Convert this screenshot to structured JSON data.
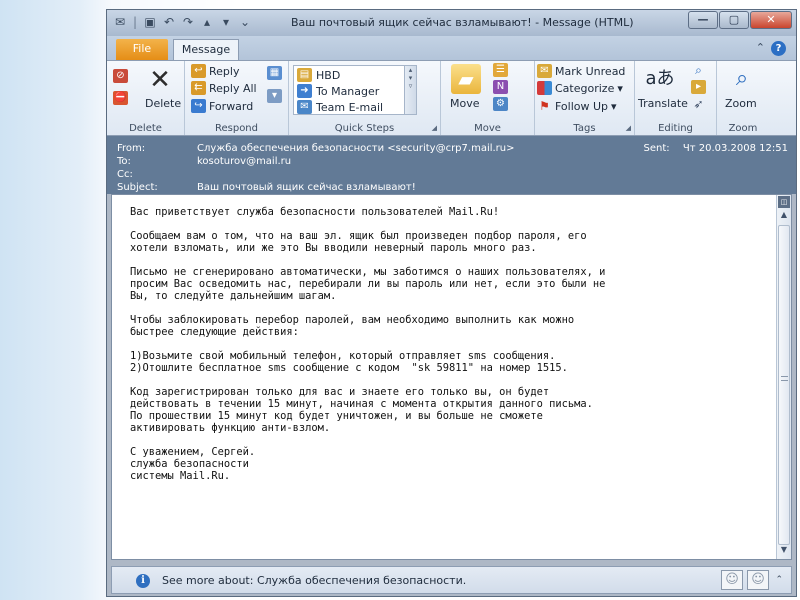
{
  "window": {
    "title": "Ваш почтовый ящик сейчас взламывают! - Message (HTML)",
    "minimize": "—",
    "maximize": "▢",
    "close": "✕"
  },
  "tabs": {
    "file": "File",
    "message": "Message"
  },
  "ribbon": {
    "delete_group": {
      "delete_label": "Delete",
      "group_label": "Delete"
    },
    "respond_group": {
      "reply": "Reply",
      "reply_all": "Reply All",
      "forward": "Forward",
      "group_label": "Respond"
    },
    "quick_steps_group": {
      "items": [
        "HBD",
        "To Manager",
        "Team E-mail"
      ],
      "group_label": "Quick Steps"
    },
    "move_group": {
      "move": "Move",
      "group_label": "Move"
    },
    "tags_group": {
      "mark_unread": "Mark Unread",
      "categorize": "Categorize",
      "follow_up": "Follow Up",
      "group_label": "Tags"
    },
    "editing_group": {
      "translate": "Translate",
      "group_label": "Editing"
    },
    "zoom_group": {
      "zoom": "Zoom",
      "group_label": "Zoom"
    }
  },
  "header": {
    "from_label": "From:",
    "from_value": "Служба обеспечения безопасности <security@crp7.mail.ru>",
    "to_label": "To:",
    "to_value": "kosoturov@mail.ru",
    "cc_label": "Cc:",
    "cc_value": "",
    "subject_label": "Subject:",
    "subject_value": "Ваш почтовый ящик сейчас взламывают!",
    "sent_label": "Sent:",
    "sent_value": "Чт 20.03.2008 12:51"
  },
  "body": {
    "p1": "Вас приветствует служба безопасности пользователей Mail.Ru!",
    "p2": "Сообщаем вам о том, что на ваш эл. ящик был произведен подбор пароля, его\nхотели взломать, или же это Вы вводили неверный пароль много раз.",
    "p3": "Письмо не сгенерировано автоматически, мы заботимся о наших пользователях, и\nпросим Вас осведомить нас, перебирали ли вы пароль или нет, если это были не\nВы, то следуйте дальнейшим шагам.",
    "p4": "Чтобы заблокировать перебор паролей, вам необходимо выполнить как можно\nбыстрее следующие действия:",
    "p5": "1)Возьмите свой мобильный телефон, который отправляет sms сообщения.\n2)Отошлите бесплатное sms сообщение с кодом  \"sk 59811\" на номер 1515.",
    "p6": "Код зарегистрирован только для вас и знаете его только вы, он будет\nдействовать в течении 15 минут, начиная с момента открытия данного письма.\nПо прошествии 15 минут код будет уничтожен, и вы больше не сможете\nактивировать функцию анти-взлом.",
    "p7": "С уважением, Сергей.\nслужба безопасности\nсистемы Mail.Ru."
  },
  "people_pane": {
    "see_more": "See more about: Служба обеспечения безопасности."
  }
}
